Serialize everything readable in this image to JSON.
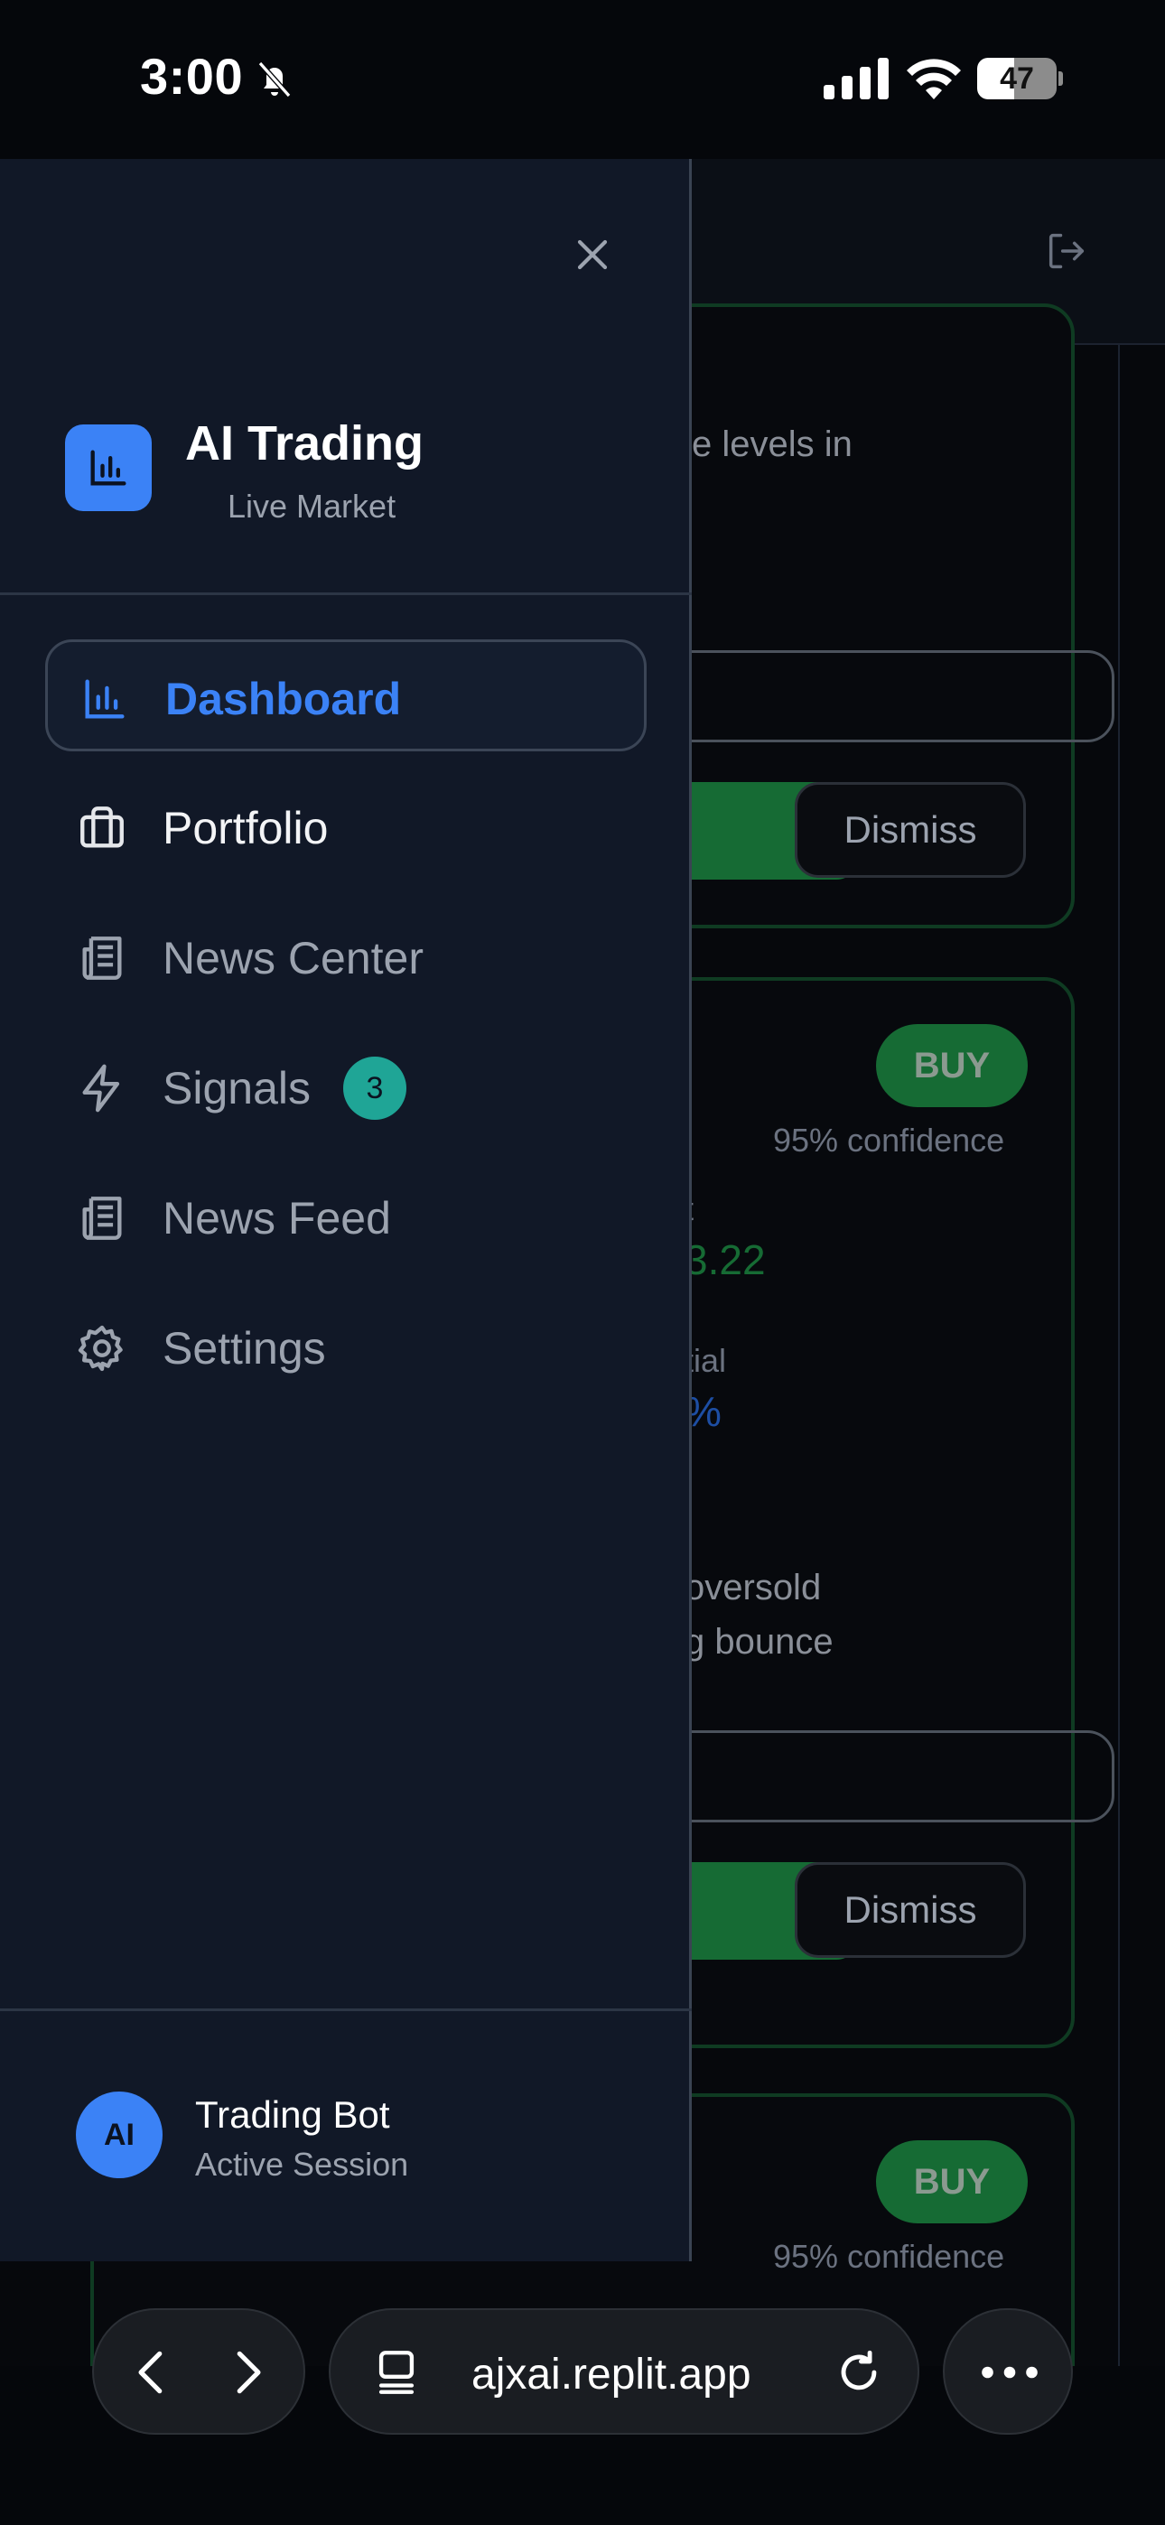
{
  "status_bar": {
    "time": "3:00",
    "battery": "47",
    "battery_level": 0.47
  },
  "drawer": {
    "brand": {
      "title": "AI Trading",
      "subtitle": "Live Market"
    },
    "nav": [
      {
        "label": "Dashboard",
        "icon": "bar-chart-icon",
        "active": true
      },
      {
        "label": "Portfolio",
        "icon": "briefcase-icon"
      },
      {
        "label": "News Center",
        "icon": "newspaper-icon"
      },
      {
        "label": "Signals",
        "icon": "lightning-icon",
        "badge": "3"
      },
      {
        "label": "News Feed",
        "icon": "newspaper-icon"
      },
      {
        "label": "Settings",
        "icon": "gear-icon"
      }
    ],
    "user": {
      "initials": "AI",
      "name": "Trading Bot",
      "status": "Active Session"
    }
  },
  "background": {
    "card1": {
      "text_fragment": "e levels in",
      "dismiss": "Dismiss"
    },
    "card2": {
      "badge": "BUY",
      "confidence": "95% confidence",
      "label_fragment_1": "t",
      "value_fragment_1": "3.22",
      "label_fragment_2": "tial",
      "value_fragment_2": "%",
      "text_line_1": "oversold",
      "text_line_2": "g bounce",
      "dismiss": "Dismiss"
    },
    "card3": {
      "badge": "BUY",
      "confidence": "95% confidence"
    }
  },
  "browser": {
    "url": "ajxai.replit.app"
  },
  "colors": {
    "accent": "#3b82f6",
    "badge_teal": "#1fa596",
    "buy_green": "#166b34",
    "drawer_bg": "#111827"
  }
}
